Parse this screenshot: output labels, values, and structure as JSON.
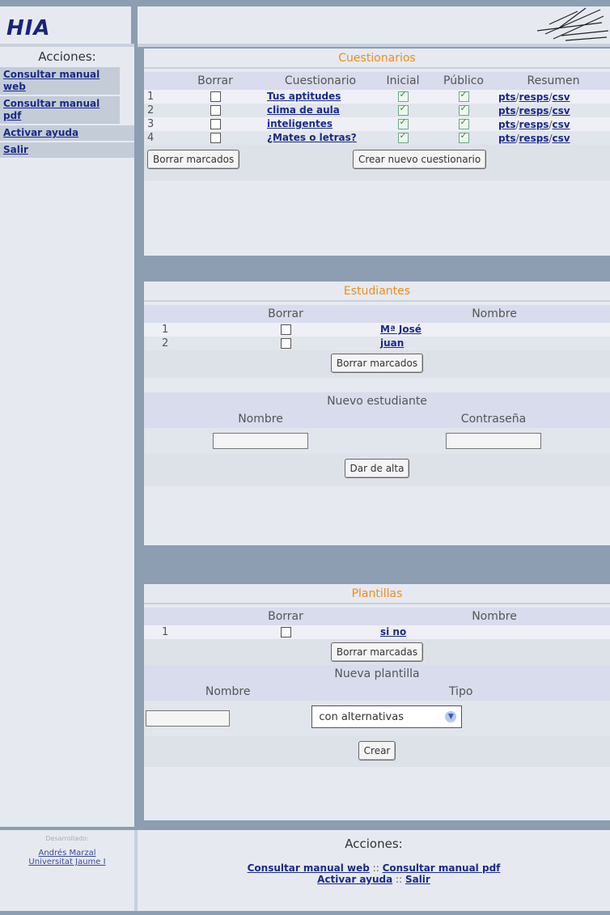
{
  "app": {
    "logo": "HIA"
  },
  "sidebar": {
    "title": "Acciones:",
    "items": [
      {
        "label": "Consultar manual web"
      },
      {
        "label": "Consultar manual pdf"
      },
      {
        "label": "Activar ayuda"
      },
      {
        "label": "Salir"
      }
    ]
  },
  "cuestionarios": {
    "title": "Cuestionarios",
    "headers": [
      "",
      "Borrar",
      "Cuestionario",
      "Inicial",
      "Público",
      "Resumen"
    ],
    "rows": [
      {
        "num": "1",
        "name": "Tus aptitudes",
        "inicial": true,
        "publico": true
      },
      {
        "num": "2",
        "name": "clima de aula",
        "inicial": true,
        "publico": true
      },
      {
        "num": "3",
        "name": "inteligentes",
        "inicial": true,
        "publico": true
      },
      {
        "num": "4",
        "name": "¿Mates o letras?",
        "inicial": true,
        "publico": true
      }
    ],
    "summary_links": {
      "pts": "pts",
      "resps": "resps",
      "csv": "csv",
      "sep": "/"
    },
    "delete_button": "Borrar marcados",
    "create_button": "Crear nuevo cuestionario"
  },
  "estudiantes": {
    "title": "Estudiantes",
    "headers": [
      "",
      "Borrar",
      "Nombre"
    ],
    "rows": [
      {
        "num": "1",
        "name": "Mª José"
      },
      {
        "num": "2",
        "name": "juan"
      }
    ],
    "delete_button": "Borrar marcados",
    "new_title": "Nuevo estudiante",
    "new_name_label": "Nombre",
    "new_password_label": "Contraseña",
    "add_button": "Dar de alta"
  },
  "plantillas": {
    "title": "Plantillas",
    "headers": [
      "",
      "Borrar",
      "Nombre"
    ],
    "rows": [
      {
        "num": "1",
        "name": "si no"
      }
    ],
    "delete_button": "Borrar marcadas",
    "new_title": "Nueva plantilla",
    "new_name_label": "Nombre",
    "new_type_label": "Tipo",
    "type_selected": "con alternativas",
    "create_button": "Crear"
  },
  "footer": {
    "credit_small": "Desarrollado:",
    "author": "Andrés Marzal",
    "institution": "Universitat Jaume I",
    "actions_title": "Acciones:",
    "links": {
      "web": "Consultar manual web",
      "pdf": "Consultar manual pdf",
      "ayuda": "Activar ayuda",
      "salir": "Salir",
      "sep": "::"
    }
  }
}
